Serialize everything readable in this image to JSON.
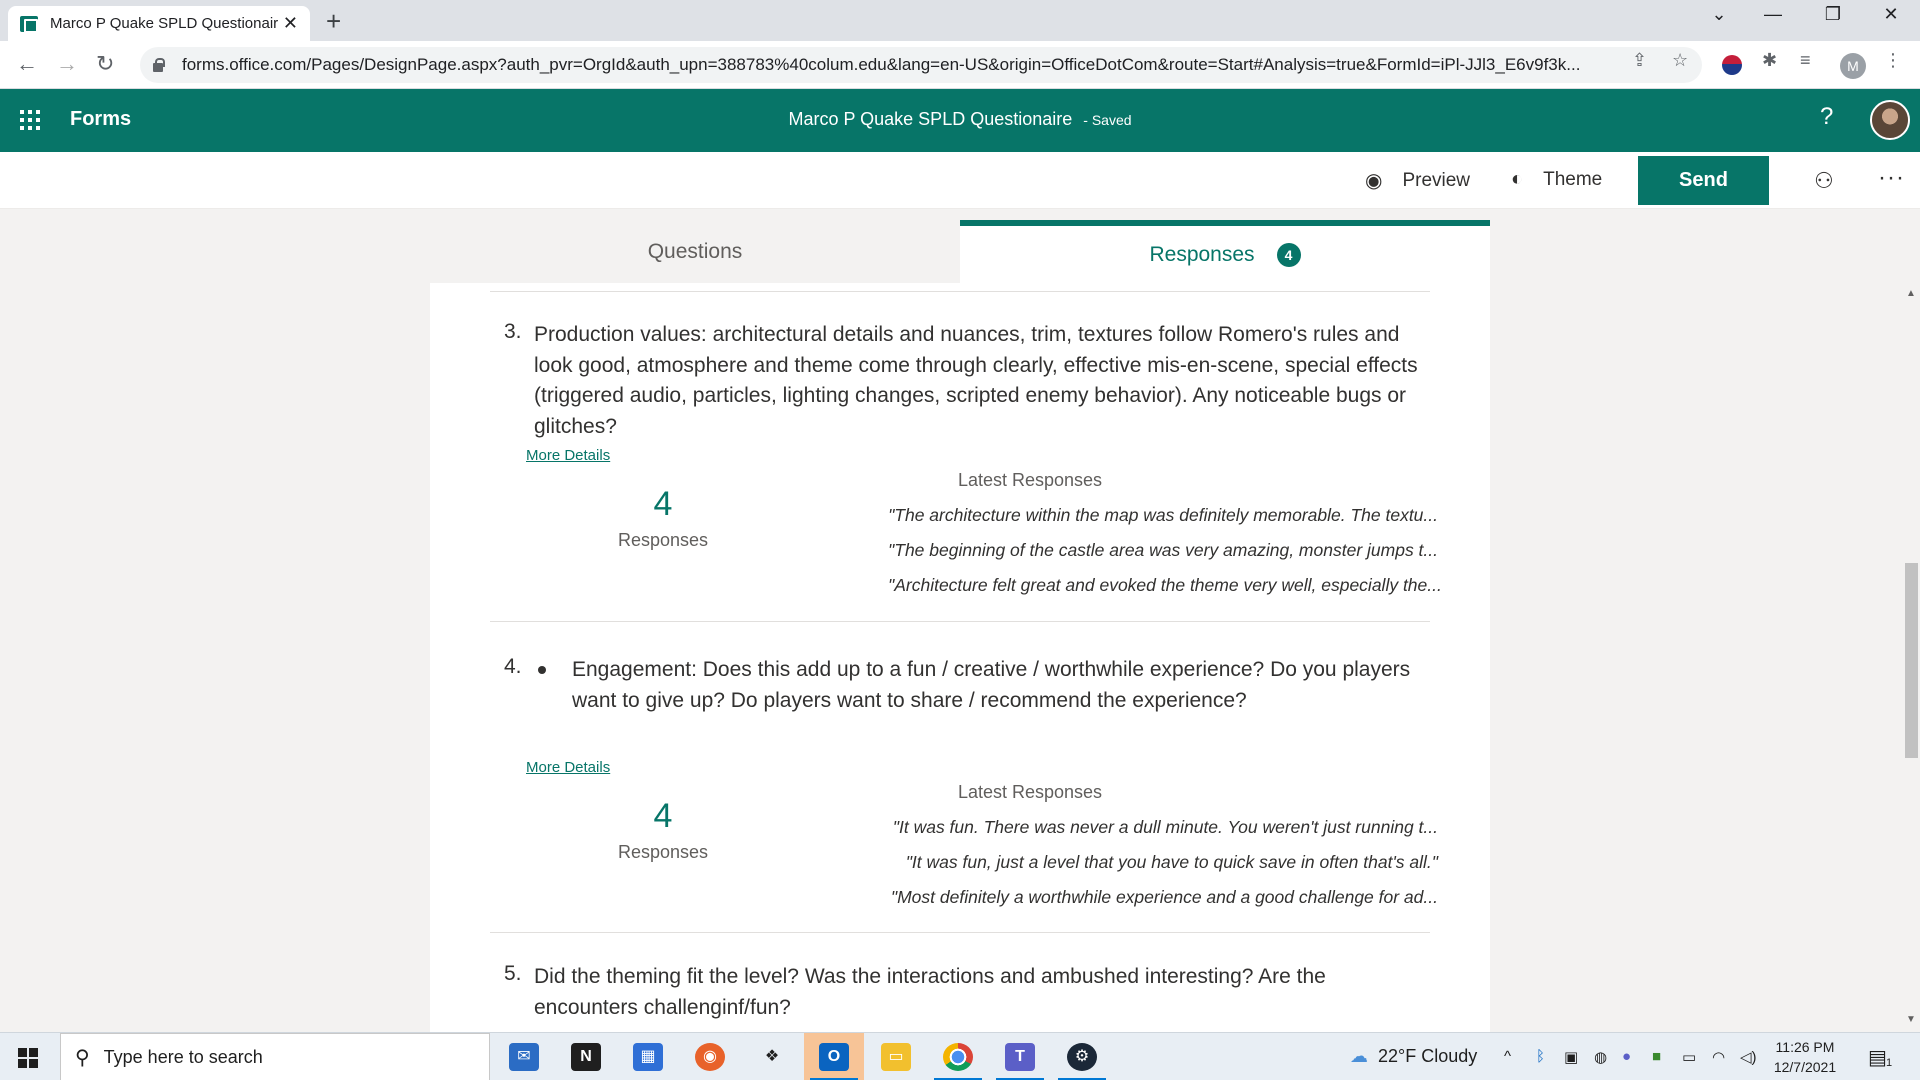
{
  "browser": {
    "tab_title": "Marco P Quake SPLD Questionaire",
    "tab_close": "✕",
    "new_tab": "+",
    "url": "forms.office.com/Pages/DesignPage.aspx?auth_pvr=OrgId&auth_upn=388783%40colum.edu&lang=en-US&origin=OfficeDotCom&route=Start#Analysis=true&FormId=iPl-JJl3_E6v9f3k...",
    "profile_initial": "M"
  },
  "header": {
    "app_name": "Forms",
    "form_title": "Marco P Quake SPLD Questionaire",
    "saved_status": "- Saved",
    "help": "?"
  },
  "toolbar": {
    "preview_label": "Preview",
    "theme_label": "Theme",
    "send_label": "Send"
  },
  "tabs": {
    "questions_label": "Questions",
    "responses_label": "Responses",
    "responses_count": "4"
  },
  "questions": [
    {
      "number": "3.",
      "text": "Production values: architectural details and nuances, trim, textures follow Romero's rules and look good, atmosphere and theme come through clearly, effective mis-en-scene, special effects (triggered audio, particles, lighting changes, scripted enemy behavior). Any noticeable bugs or glitches?",
      "more_details": "More Details",
      "count": "4",
      "count_label": "Responses",
      "latest_heading": "Latest Responses",
      "responses": [
        "\"The architecture within the map was definitely memorable. The textu...",
        "\"The beginning of the castle area was very amazing, monster jumps t...",
        "\"Architecture felt great and evoked the theme very well, especially the..."
      ]
    },
    {
      "number": "4.",
      "text": "Engagement: Does this add up to a fun / creative / worthwhile experience? Do you players want to give up? Do players want to share / recommend the experience?",
      "more_details": "More Details",
      "count": "4",
      "count_label": "Responses",
      "latest_heading": "Latest Responses",
      "responses": [
        "\"It was fun. There was never a dull minute. You weren't just running t...",
        "\"It was fun, just a level that you have to quick save in often that's all.\"",
        "\"Most definitely a worthwhile experience and a good challenge for ad..."
      ]
    },
    {
      "number": "5.",
      "text": "Did the theming fit the level? Was the interactions and ambushed interesting? Are the encounters challenginf/fun?"
    }
  ],
  "taskbar": {
    "search_placeholder": "Type here to search",
    "weather": "22°F  Cloudy",
    "time": "11:26 PM",
    "date": "12/7/2021",
    "notification_count": "1"
  },
  "colors": {
    "brand": "#077568",
    "page_bg": "#f3f2f1"
  }
}
